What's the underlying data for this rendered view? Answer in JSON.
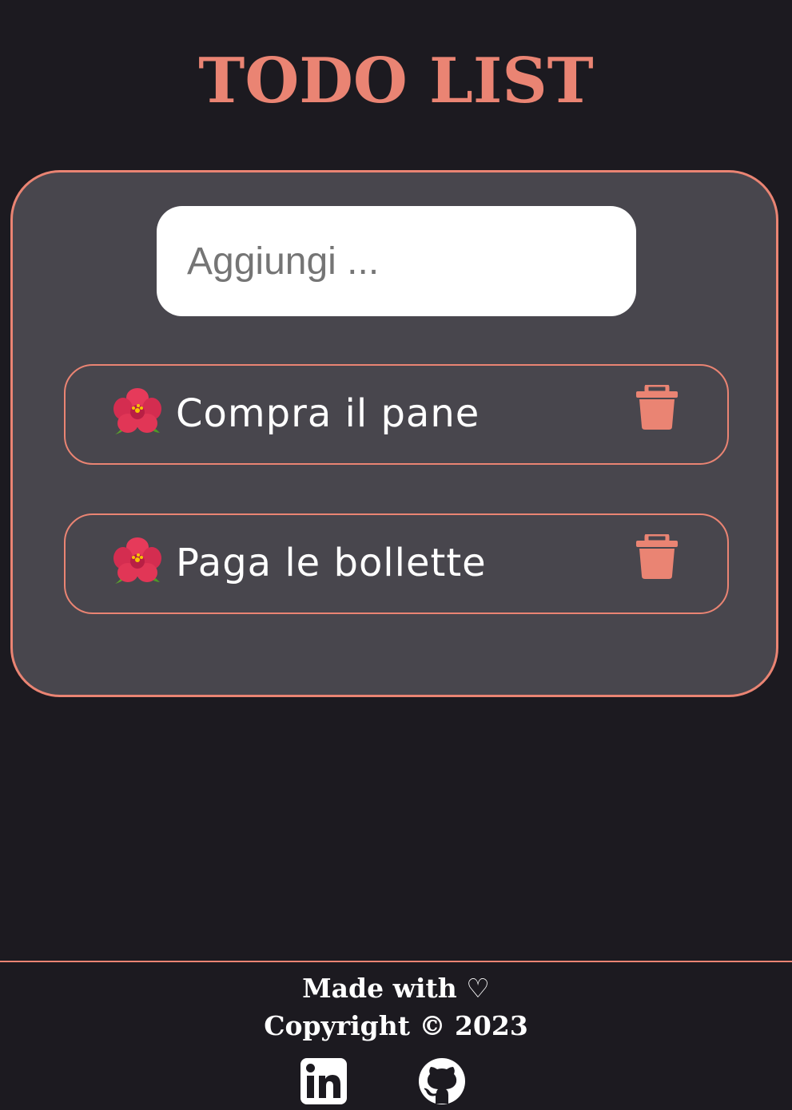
{
  "header": {
    "title": "TODO LIST"
  },
  "input": {
    "placeholder": "Aggiungi ...",
    "value": ""
  },
  "todos": [
    {
      "text": "Compra il pane",
      "icon": "hibiscus-icon",
      "delete_icon": "trash-icon"
    },
    {
      "text": "Paga le bollette",
      "icon": "hibiscus-icon",
      "delete_icon": "trash-icon"
    }
  ],
  "footer": {
    "made_with": "Made with ♡",
    "copyright": "Copyright © 2023",
    "social": [
      {
        "icon": "linkedin-icon"
      },
      {
        "icon": "github-icon"
      }
    ]
  },
  "colors": {
    "background": "#1c1a20",
    "card": "#48464d",
    "accent": "#ea8473",
    "text": "#ffffff"
  }
}
